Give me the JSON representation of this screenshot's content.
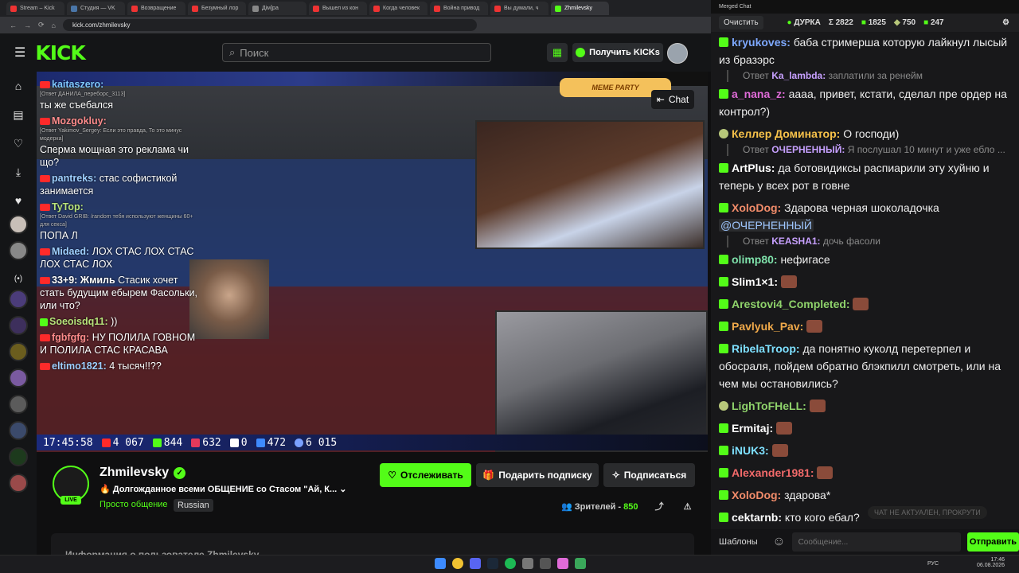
{
  "browser": {
    "tabs": [
      "Stream – Kick",
      "Студия — VK",
      "Возвращение",
      "Безумный лор",
      "Дiм]ра",
      "Вышел из кон",
      "Когда человек",
      "Война привод",
      "Вы думали, ч",
      "Zhmilevsky"
    ],
    "url": "kick.com/zhmilevsky"
  },
  "kick": {
    "logo": "KICK",
    "search_placeholder": "Поиск",
    "get_kicks": "Получить KICKs"
  },
  "video": {
    "chat_button": "Chat",
    "meme_party": "MEME PARTY",
    "overlay_chat": [
      {
        "name": "kaitaszero:",
        "sub": "[Ответ ДАНИЛА_переборс_3113]",
        "text": "ты же съебался"
      },
      {
        "name": "Mozgokluy:",
        "sub": "[Ответ Yakimov_Sergey: Если это правда, То это минус модерка]",
        "text": "Сперма мощная это реклама чи що?"
      },
      {
        "name": "pantreks:",
        "sub": "",
        "text": "стас софистикой занимается"
      },
      {
        "name": "TyTop:",
        "sub": "[Ответ David GRIB: /random тебя используют женщины 60+ для секса]",
        "text": "ПОПА Л"
      },
      {
        "name": "Midaed:",
        "sub": "",
        "text": "ЛОХ СТАС ЛОХ СТАС ЛОХ СТАС ЛОХ"
      },
      {
        "name": "33+9: Жмиль",
        "sub": "",
        "text": "Стасик хочет стать будущим ебырем Фасольки, или что?"
      },
      {
        "name": "Soeoisdq11:",
        "sub": "",
        "text": "))"
      },
      {
        "name": "fgbfgfg:",
        "sub": "",
        "text": "НУ ПОЛИЛА ГОВНОМ И ПОЛИЛА СТАС КРАСАВА"
      },
      {
        "name": "eltimo1821:",
        "sub": "",
        "text": "4 тысяч!!??"
      }
    ],
    "stats": {
      "time": "17:45:58",
      "youtube": "4 067",
      "kick": "844",
      "vk": "632",
      "r": "0",
      "other": "472",
      "total": "6 015"
    }
  },
  "stream": {
    "name": "Zhmilevsky",
    "title": "Долгожданное всеми ОБЩЕНИЕ со Стасом \"Ай, К...",
    "category": "Просто общение",
    "language": "Russian",
    "live": "LIVE",
    "follow": "Отслеживать",
    "gift": "Подарить подписку",
    "subscribe": "Подписаться",
    "viewers_label": "Зрителей -",
    "viewers": "850",
    "about": "Информация о пользователе Zhmilevsky"
  },
  "chat": {
    "window_title": "Merged Chat",
    "clear": "Очистить",
    "status": "ДУРКА",
    "total": "Σ 2822",
    "kick_count": "1825",
    "c2": "750",
    "c3": "247",
    "templates": "Шаблоны",
    "input_placeholder": "Сообщение...",
    "send": "Отправить",
    "not_actual": "ЧАТ НЕ АКТУАЛЕН, ПРОКРУТИ",
    "messages": [
      {
        "user": "kryukoves:",
        "color": "#7ea9ff",
        "text": "баба стримерша которую лайкнул лысый из бразэрс",
        "reply_to": "Ka_lambda:",
        "reply": "заплатили за ренейм"
      },
      {
        "user": "a_nana_z:",
        "color": "#e06bd8",
        "text": "аааа, привет, кстати, сделал пре ордер на контрол?)"
      },
      {
        "user": "Келлер Доминатор:",
        "color": "#f7c24a",
        "text": "О господи)",
        "reply_to": "ОЧЕРНЕННЫЙ:",
        "reply": "Я послушал 10 минут и уже ебло ..."
      },
      {
        "user": "ArtPlus:",
        "color": "#ffffff",
        "text": "да ботовидиксы распиарили эту хуйню и теперь у всех рот в говне"
      },
      {
        "user": "XoloDog:",
        "color": "#f28c6a",
        "text": "Здарова черная шоколадочка",
        "mention": "@ОЧЕРНЕННЫЙ",
        "reply_to": "KEASHA1:",
        "reply": "дочь фасоли"
      },
      {
        "user": "olimp80:",
        "color": "#7fe2ab",
        "text": "нефигасе"
      },
      {
        "user": "Slim1×1:",
        "color": "#ffffff",
        "text": ""
      },
      {
        "user": "Arestovi4_Completed:",
        "color": "#8fd36b",
        "text": ""
      },
      {
        "user": "Pavlyuk_Pav:",
        "color": "#f0a94a",
        "text": ""
      },
      {
        "user": "RibelaTroop:",
        "color": "#7ee0ff",
        "text": "да понятно куколд перетерпел и обосраля, пойдем обратно блэкпилл смотреть, или на чем мы остановились?"
      },
      {
        "user": "LighToFHeLL:",
        "color": "#8fd36b",
        "text": ""
      },
      {
        "user": "Ermitaj:",
        "color": "#ffffff",
        "text": ""
      },
      {
        "user": "iNUK3:",
        "color": "#7ee0ff",
        "text": ""
      },
      {
        "user": "Alexander1981:",
        "color": "#f26a6a",
        "text": ""
      },
      {
        "user": "XoloDog:",
        "color": "#f28c6a",
        "text": "здарова*"
      },
      {
        "user": "cektarnb:",
        "color": "#ffffff",
        "text": "кто кого ебал?"
      }
    ]
  },
  "taskbar": {
    "lang": "РУС",
    "time": "17:46",
    "date": "06.08.2026"
  }
}
